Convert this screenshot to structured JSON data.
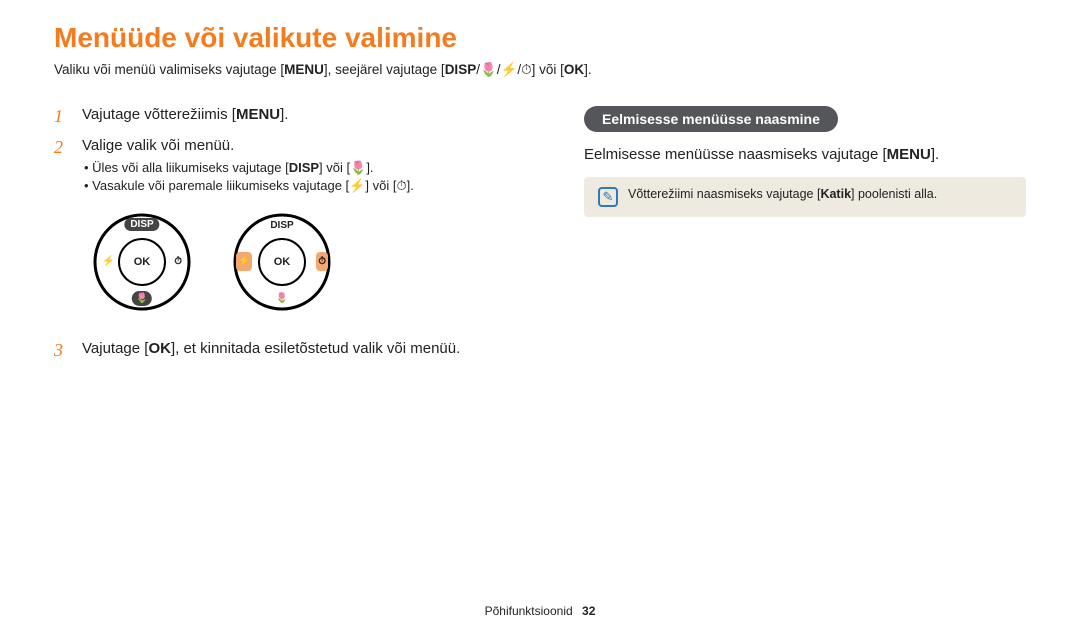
{
  "title": "Menüüde või valikute valimine",
  "intro_parts": {
    "p1": "Valiku või menüü valimiseks vajutage [",
    "menu": "MENU",
    "p2": "], seejärel vajutage [",
    "disp": "DISP",
    "slash1": "/",
    "macro": "🌷",
    "slash2": "/",
    "flash": "⚡",
    "slash3": "/",
    "timer": "⏱",
    "p3": "] või [",
    "ok": "OK",
    "p4": "]."
  },
  "steps": {
    "s1": {
      "num": "1",
      "a": "Vajutage võtterežiimis [",
      "menu": "MENU",
      "b": "]."
    },
    "s2": {
      "num": "2",
      "text": "Valige valik või menüü.",
      "sub1": {
        "a": "Üles või alla liikumiseks vajutage [",
        "disp": "DISP",
        "mid": "] või [",
        "macro": "🌷",
        "b": "]."
      },
      "sub2": {
        "a": "Vasakule või paremale liikumiseks vajutage [",
        "flash": "⚡",
        "mid": "] või [",
        "timer": "⏱",
        "b": "]."
      }
    },
    "s3": {
      "num": "3",
      "a": "Vajutage [",
      "ok": "OK",
      "b": "], et kinnitada esiletõstetud valik või menüü."
    }
  },
  "dial": {
    "disp": "DISP",
    "ok": "OK",
    "flash": "⚡",
    "timer": "⏱",
    "macro": "🌷"
  },
  "right": {
    "pill": "Eelmisesse menüüsse naasmine",
    "desc_a": "Eelmisesse menüüsse naasmiseks vajutage [",
    "desc_menu": "MENU",
    "desc_b": "].",
    "note_a": "Võtterežiimi naasmiseks vajutage [",
    "note_bold": "Katik",
    "note_b": "] poolenisti alla."
  },
  "footer": {
    "section": "Põhifunktsioonid",
    "page": "32"
  }
}
